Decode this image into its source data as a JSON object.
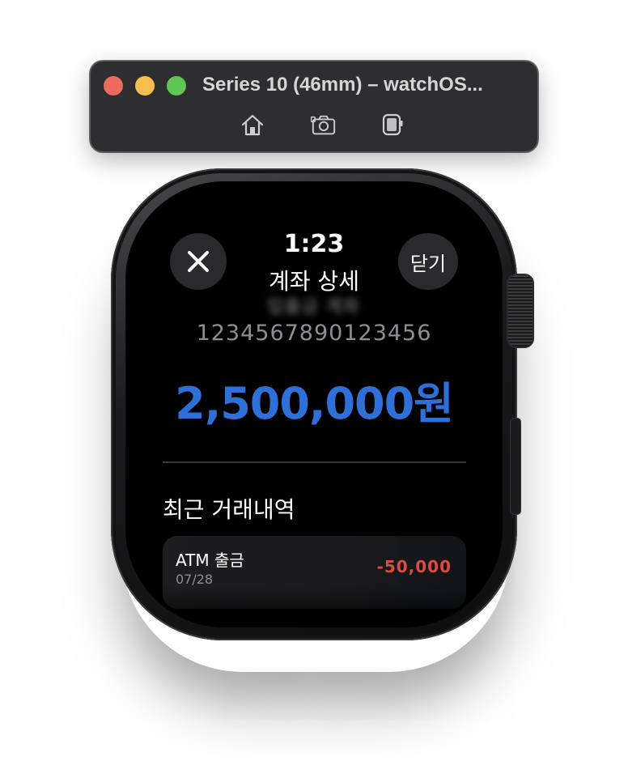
{
  "window": {
    "title": "Series 10 (46mm) – watchOS...",
    "controls": {
      "close_color": "#ed6a5e",
      "minimize_color": "#f4bf4f",
      "zoom_color": "#61c554"
    },
    "toolbar_icons": [
      "home-icon",
      "screenshot-icon",
      "rotate-icon"
    ]
  },
  "watch": {
    "status_time": "1:23",
    "screen_title": "계좌 상세",
    "obscured_text": "입출금 계좌",
    "close_icon": "close-icon",
    "dismiss_label": "닫기",
    "account_number": "1234567890123456",
    "balance": "2,500,000원",
    "balance_color": "#2f6fd8",
    "recent_title": "최근 거래내역",
    "transactions": [
      {
        "name": "ATM 출금",
        "date": "07/28",
        "amount": "-50,000",
        "amount_color": "#e04b3f"
      }
    ]
  }
}
